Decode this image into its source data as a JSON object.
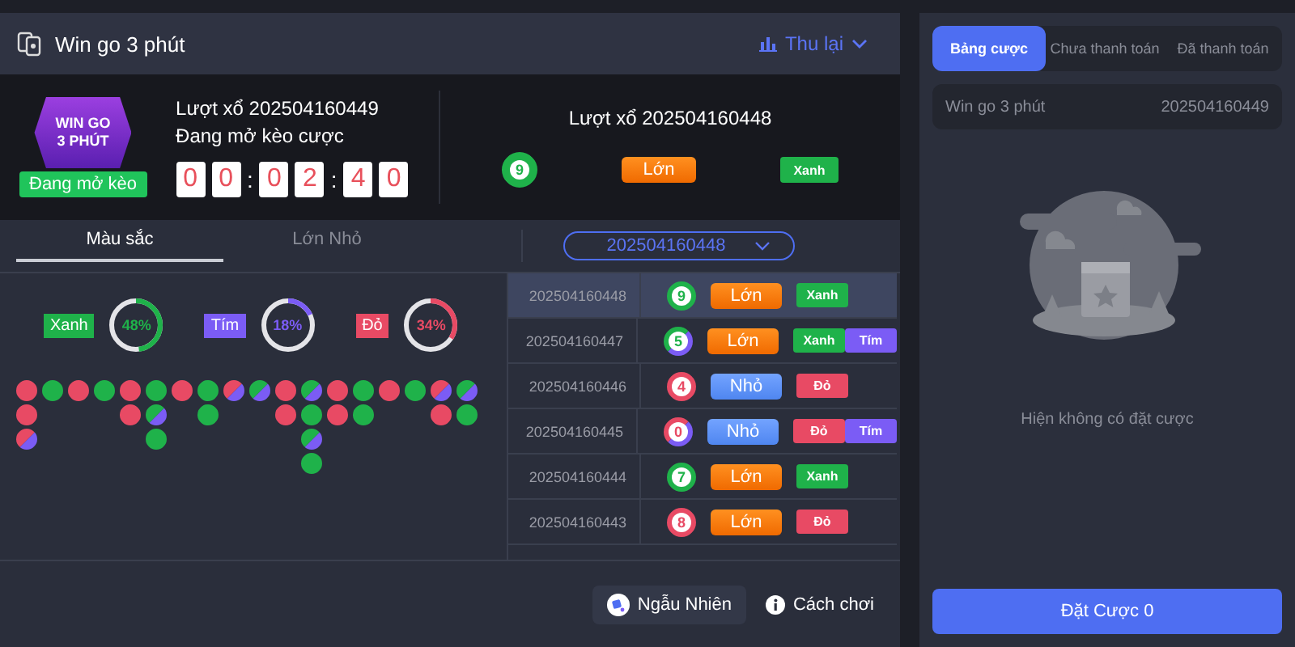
{
  "header": {
    "title": "Win go 3 phút",
    "action": "Thu lại"
  },
  "current_round": {
    "logo_lines": [
      "WIN GO",
      "3 PHÚT"
    ],
    "status_badge": "Đang mở kèo",
    "round_label": "Lượt xổ 202504160449",
    "status_text": "Đang mở kèo cược",
    "timer": [
      {
        "kind": "digit",
        "text": "0"
      },
      {
        "kind": "digit",
        "text": "0"
      },
      {
        "kind": "sep",
        "text": ":"
      },
      {
        "kind": "digit",
        "text": "0"
      },
      {
        "kind": "digit",
        "text": "2"
      },
      {
        "kind": "sep",
        "text": ":"
      },
      {
        "kind": "digit",
        "text": "4"
      },
      {
        "kind": "digit",
        "text": "0"
      }
    ]
  },
  "last_result": {
    "round_label": "Lượt xổ 202504160448",
    "ball": {
      "number": "9",
      "segments": [
        {
          "color": "#1fb24a"
        }
      ]
    },
    "size": {
      "kind": "big",
      "label": "Lớn"
    },
    "tags": [
      {
        "label": "Xanh",
        "color": "#1fb24a"
      }
    ]
  },
  "tabs": [
    {
      "label": "Màu sắc",
      "selected": true
    },
    {
      "label": "Lớn Nhỏ",
      "selected": false
    }
  ],
  "period_select": {
    "value": "202504160448"
  },
  "stats": [
    {
      "label": "Xanh",
      "percent": "48%",
      "level": 0.48,
      "color": "#1fb24a"
    },
    {
      "label": "Tím",
      "percent": "18%",
      "level": 0.18,
      "color": "#7b5cf5"
    },
    {
      "label": "Đỏ",
      "percent": "34%",
      "level": 0.34,
      "color": "#e84a64"
    }
  ],
  "trend": [
    [
      {
        "segments": [
          {
            "color": "#e84a64"
          }
        ]
      },
      {
        "segments": [
          {
            "color": "#e84a64"
          }
        ]
      },
      {
        "segments": [
          {
            "color": "#e84a64"
          },
          {
            "color": "#7b5cf5"
          }
        ]
      }
    ],
    [
      {
        "segments": [
          {
            "color": "#1fb24a"
          }
        ]
      }
    ],
    [
      {
        "segments": [
          {
            "color": "#e84a64"
          }
        ]
      }
    ],
    [
      {
        "segments": [
          {
            "color": "#1fb24a"
          }
        ]
      }
    ],
    [
      {
        "segments": [
          {
            "color": "#e84a64"
          }
        ]
      },
      {
        "segments": [
          {
            "color": "#e84a64"
          }
        ]
      }
    ],
    [
      {
        "segments": [
          {
            "color": "#1fb24a"
          }
        ]
      },
      {
        "segments": [
          {
            "color": "#1fb24a"
          },
          {
            "color": "#7b5cf5"
          }
        ]
      },
      {
        "segments": [
          {
            "color": "#1fb24a"
          }
        ]
      }
    ],
    [
      {
        "segments": [
          {
            "color": "#e84a64"
          }
        ]
      }
    ],
    [
      {
        "segments": [
          {
            "color": "#1fb24a"
          }
        ]
      },
      {
        "segments": [
          {
            "color": "#1fb24a"
          }
        ]
      }
    ],
    [
      {
        "segments": [
          {
            "color": "#e84a64"
          },
          {
            "color": "#7b5cf5"
          }
        ]
      }
    ],
    [
      {
        "segments": [
          {
            "color": "#1fb24a"
          },
          {
            "color": "#7b5cf5"
          }
        ]
      }
    ],
    [
      {
        "segments": [
          {
            "color": "#e84a64"
          }
        ]
      },
      {
        "segments": [
          {
            "color": "#e84a64"
          }
        ]
      }
    ],
    [
      {
        "segments": [
          {
            "color": "#1fb24a"
          },
          {
            "color": "#7b5cf5"
          }
        ]
      },
      {
        "segments": [
          {
            "color": "#1fb24a"
          }
        ]
      },
      {
        "segments": [
          {
            "color": "#1fb24a"
          },
          {
            "color": "#7b5cf5"
          }
        ]
      },
      {
        "segments": [
          {
            "color": "#1fb24a"
          }
        ]
      }
    ],
    [
      {
        "segments": [
          {
            "color": "#e84a64"
          }
        ]
      },
      {
        "segments": [
          {
            "color": "#e84a64"
          }
        ]
      }
    ],
    [
      {
        "segments": [
          {
            "color": "#1fb24a"
          }
        ]
      },
      {
        "segments": [
          {
            "color": "#1fb24a"
          }
        ]
      }
    ],
    [
      {
        "segments": [
          {
            "color": "#e84a64"
          }
        ]
      }
    ],
    [
      {
        "segments": [
          {
            "color": "#1fb24a"
          }
        ]
      }
    ],
    [
      {
        "segments": [
          {
            "color": "#e84a64"
          },
          {
            "color": "#7b5cf5"
          }
        ]
      },
      {
        "segments": [
          {
            "color": "#e84a64"
          }
        ]
      }
    ],
    [
      {
        "segments": [
          {
            "color": "#1fb24a"
          },
          {
            "color": "#7b5cf5"
          }
        ]
      },
      {
        "segments": [
          {
            "color": "#1fb24a"
          }
        ]
      }
    ]
  ],
  "results": [
    {
      "period": "202504160448",
      "selected": true,
      "ball": {
        "number": "9",
        "segments": [
          {
            "color": "#1fb24a"
          }
        ]
      },
      "size": {
        "kind": "big",
        "label": "Lớn"
      },
      "tags": [
        {
          "label": "Xanh",
          "color": "#1fb24a"
        }
      ]
    },
    {
      "period": "202504160447",
      "selected": false,
      "ball": {
        "number": "5",
        "segments": [
          {
            "color": "#1fb24a"
          },
          {
            "color": "#7b5cf5"
          }
        ]
      },
      "size": {
        "kind": "big",
        "label": "Lớn"
      },
      "tags": [
        {
          "label": "Xanh",
          "color": "#1fb24a"
        },
        {
          "label": "Tím",
          "color": "#7b5cf5"
        }
      ]
    },
    {
      "period": "202504160446",
      "selected": false,
      "ball": {
        "number": "4",
        "segments": [
          {
            "color": "#e84a64"
          }
        ]
      },
      "size": {
        "kind": "small",
        "label": "Nhỏ"
      },
      "tags": [
        {
          "label": "Đỏ",
          "color": "#e84a64"
        }
      ]
    },
    {
      "period": "202504160445",
      "selected": false,
      "ball": {
        "number": "0",
        "segments": [
          {
            "color": "#e84a64"
          },
          {
            "color": "#7b5cf5"
          }
        ]
      },
      "size": {
        "kind": "small",
        "label": "Nhỏ"
      },
      "tags": [
        {
          "label": "Đỏ",
          "color": "#e84a64"
        },
        {
          "label": "Tím",
          "color": "#7b5cf5"
        }
      ]
    },
    {
      "period": "202504160444",
      "selected": false,
      "ball": {
        "number": "7",
        "segments": [
          {
            "color": "#1fb24a"
          }
        ]
      },
      "size": {
        "kind": "big",
        "label": "Lớn"
      },
      "tags": [
        {
          "label": "Xanh",
          "color": "#1fb24a"
        }
      ]
    },
    {
      "period": "202504160443",
      "selected": false,
      "ball": {
        "number": "8",
        "segments": [
          {
            "color": "#e84a64"
          }
        ]
      },
      "size": {
        "kind": "big",
        "label": "Lớn"
      },
      "tags": [
        {
          "label": "Đỏ",
          "color": "#e84a64"
        }
      ]
    }
  ],
  "footer": {
    "random_button": "Ngẫu Nhiên",
    "help_link": "Cách chơi"
  },
  "bet_panel": {
    "tabs": [
      {
        "label": "Bảng cược",
        "selected": true
      },
      {
        "label": "Chưa thanh toán",
        "selected": false
      },
      {
        "label": "Đã thanh toán",
        "selected": false
      }
    ],
    "game": "Win go 3 phút",
    "period": "202504160449",
    "empty_text": "Hiện không có đặt cược",
    "submit": "Đặt Cược 0"
  }
}
